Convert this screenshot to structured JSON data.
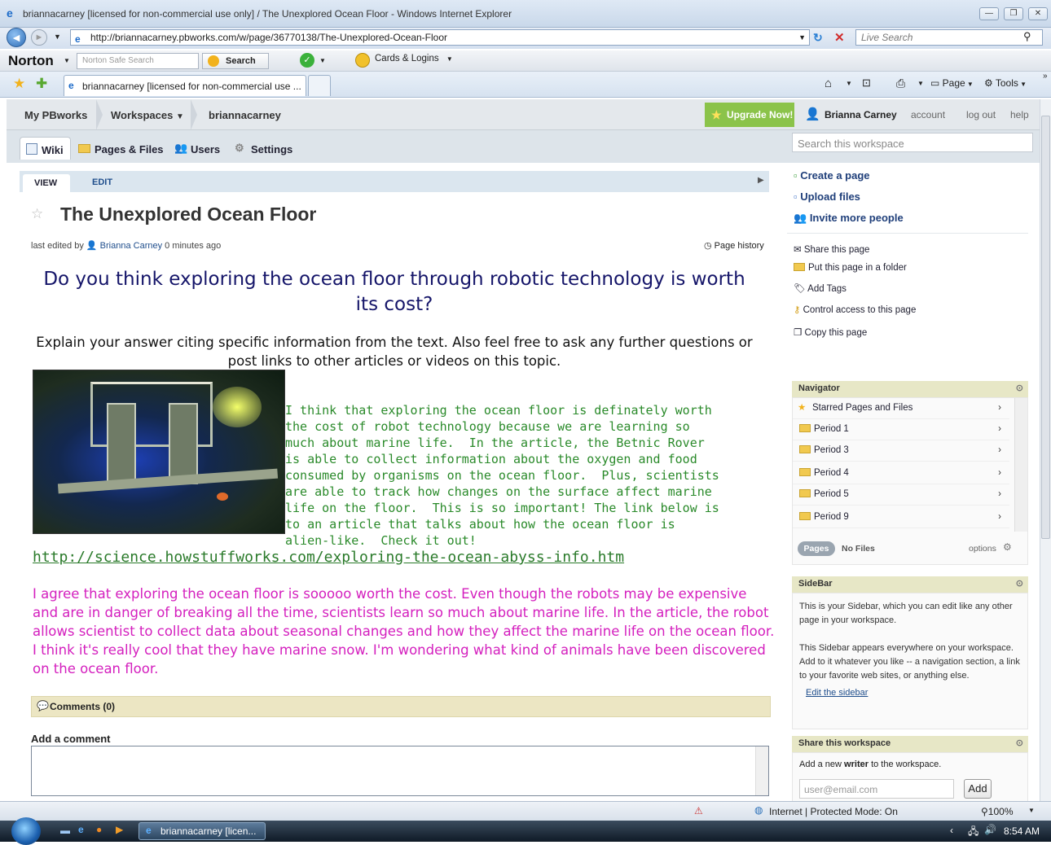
{
  "window": {
    "title": "briannacarney [licensed for non-commercial use only] / The Unexplored Ocean Floor - Windows Internet Explorer"
  },
  "addressbar": {
    "url": "http://briannacarney.pbworks.com/w/page/36770138/The-Unexplored-Ocean-Floor",
    "live_search_placeholder": "Live Search"
  },
  "norton": {
    "brand": "Norton",
    "search_placeholder": "Norton Safe Search",
    "search_button": "Search",
    "cards_logins": "Cards & Logins"
  },
  "favbar": {
    "tab_label": "briannacarney [licensed for non-commercial use ...",
    "page_menu": "Page",
    "tools_menu": "Tools"
  },
  "pbnav": {
    "my_pbworks": "My PBworks",
    "workspaces": "Workspaces",
    "workspace_name": "briannacarney",
    "upgrade": "Upgrade Now!",
    "user": "Brianna Carney",
    "account": "account",
    "logout": "log out",
    "help": "help"
  },
  "subnav": {
    "tabs": [
      {
        "label": "Wiki"
      },
      {
        "label": "Pages & Files"
      },
      {
        "label": "Users"
      },
      {
        "label": "Settings"
      }
    ],
    "search_placeholder": "Search this workspace"
  },
  "page": {
    "view_tab": "VIEW",
    "edit_tab": "EDIT",
    "title": "The Unexplored Ocean Floor",
    "last_edited_prefix": "last edited by",
    "last_edited_user": "Brianna Carney",
    "last_edited_time": "0 minutes ago",
    "page_history": "Page history",
    "question": "Do you think exploring the ocean floor through robotic technology is worth its cost?",
    "instructions": "Explain your answer citing specific information from the text.  Also feel free to ask any further questions or post links to other articles or videos on this topic.",
    "post1": "I think that exploring the ocean floor is definately worth\nthe cost of robot technology because we are learning so\nmuch about marine life.  In the article, the Betnic Rover\nis able to collect information about the oxygen and food\nconsumed by organisms on the ocean floor.  Plus, scientists\nare able to track how changes on the surface affect marine\nlife on the floor.  This is so important! The link below is\nto an article that talks about how the ocean floor is\nalien-like.  Check it out!",
    "link": "http://science.howstuffworks.com/exploring-the-ocean-abyss-info.htm",
    "post2": "I agree that exploring the ocean floor is sooooo worth the cost.  Even though the robots may be expensive and are in danger of breaking all the time, scientists learn so much about marine life.  In the article, the robot allows scientist to collect data about seasonal changes and how they affect the marine life on the ocean floor.  I think it's really cool that they have marine snow.  I'm wondering what kind of animals have been discovered on the ocean floor.",
    "comments": "Comments (0)",
    "add_comment": "Add a comment"
  },
  "sidebar": {
    "actions": [
      "Create a page",
      "Upload files",
      "Invite more people"
    ],
    "page_actions": [
      "Share this page",
      "Put this page in a folder",
      "Add Tags",
      "Control access to this page",
      "Copy this page"
    ],
    "navigator": {
      "title": "Navigator",
      "items": [
        "Starred Pages and Files",
        "Period 1",
        "Period 3",
        "Period 4",
        "Period 5",
        "Period 9"
      ],
      "pages_tab": "Pages",
      "files_tab": "No Files",
      "options": "options"
    },
    "sidebar_box": {
      "title": "SideBar",
      "text1": "This is your Sidebar, which you can edit like any other page in your workspace.",
      "text2": "This Sidebar appears everywhere on your workspace. Add to it whatever you like -- a navigation section, a link to your favorite web sites, or anything else.",
      "edit_link": "Edit the sidebar"
    },
    "share": {
      "title": "Share this workspace",
      "text_a": "Add a new ",
      "text_bold": "writer",
      "text_b": " to the workspace.",
      "email_placeholder": "user@email.com",
      "add_button": "Add"
    }
  },
  "statusbar": {
    "zone": "Internet | Protected Mode: On",
    "zoom": "100%"
  },
  "taskbar": {
    "task": "briannacarney [licen...",
    "clock": "8:54 AM"
  }
}
